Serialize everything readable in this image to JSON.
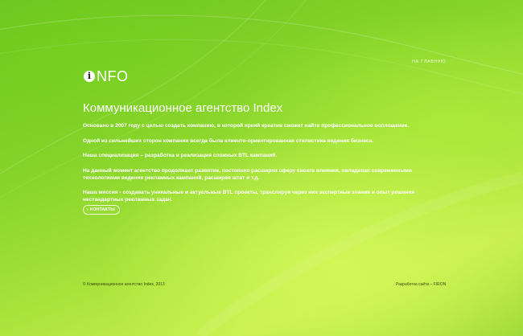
{
  "nav": {
    "home_link": "НА ГЛАВНУЮ"
  },
  "logo": {
    "icon_letter": "i",
    "text": "NFO"
  },
  "main": {
    "title": "Коммуникационное агентство Index",
    "paragraphs": [
      "Основано в 2007 году с целью создать компанию, в которой яркий креатив сможет найти профессиональное воплощение.",
      "Одной из сильнейших сторон компании всегда была клиенто-ориентированная стилистика ведения бизнеса.",
      "Наша специализация – разработка и реализация сложных BTL кампаний.",
      "На данный  момент агентство продолжает развитие, постоянно расширяя сферу своего влияния, овладевая современными технологиями ведения рекламных кампаний, расширяя штат и т.д.",
      "Наша миссия - создавать уникальные и актуальные BTL проекты, транслируя через них экспертные знания и опыт решения нестандартных рекламных задач."
    ],
    "contacts_button": "КОНТАКТЫ"
  },
  "footer": {
    "copyright": "© Коммуникационное агентство Index, 2013",
    "dev_label": "Разработка сайта – ",
    "dev_link": "FIRON"
  },
  "colors": {
    "background_dark": "#6bc51f",
    "background_light": "#c6ee4d",
    "text": "#ffffff",
    "footer_text": "#3a4a10"
  }
}
